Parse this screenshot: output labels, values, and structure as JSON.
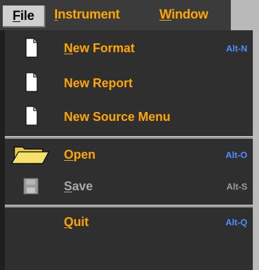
{
  "menubar": {
    "items": [
      {
        "label": "File",
        "accel": "F",
        "rest": "ile"
      },
      {
        "label": "Instrument",
        "accel": "I",
        "rest": "nstrument"
      },
      {
        "label": "Window",
        "accel": "W",
        "rest": "indow"
      }
    ]
  },
  "file_menu": {
    "items": [
      {
        "icon": "new-document-icon",
        "accel": "N",
        "rest": "ew Format",
        "shortcut": "Alt-N",
        "enabled": true
      },
      {
        "icon": "new-document-icon",
        "label": "New Report",
        "shortcut": "",
        "enabled": true
      },
      {
        "icon": "new-document-icon",
        "label": "New Source Menu",
        "shortcut": "",
        "enabled": true
      },
      {
        "icon": "open-folder-icon",
        "accel": "O",
        "rest": "pen",
        "shortcut": "Alt-O",
        "enabled": true
      },
      {
        "icon": "floppy-disk-icon",
        "accel": "S",
        "rest": "ave",
        "shortcut": "Alt-S",
        "enabled": false
      },
      {
        "icon": "",
        "accel": "Q",
        "rest": "uit",
        "shortcut": "Alt-Q",
        "enabled": true
      }
    ]
  },
  "colors": {
    "menu_text": "#ffa600",
    "shortcut_text": "#4f8cff",
    "disabled_text": "#a9a9a9",
    "background": "#2f2f2f"
  }
}
